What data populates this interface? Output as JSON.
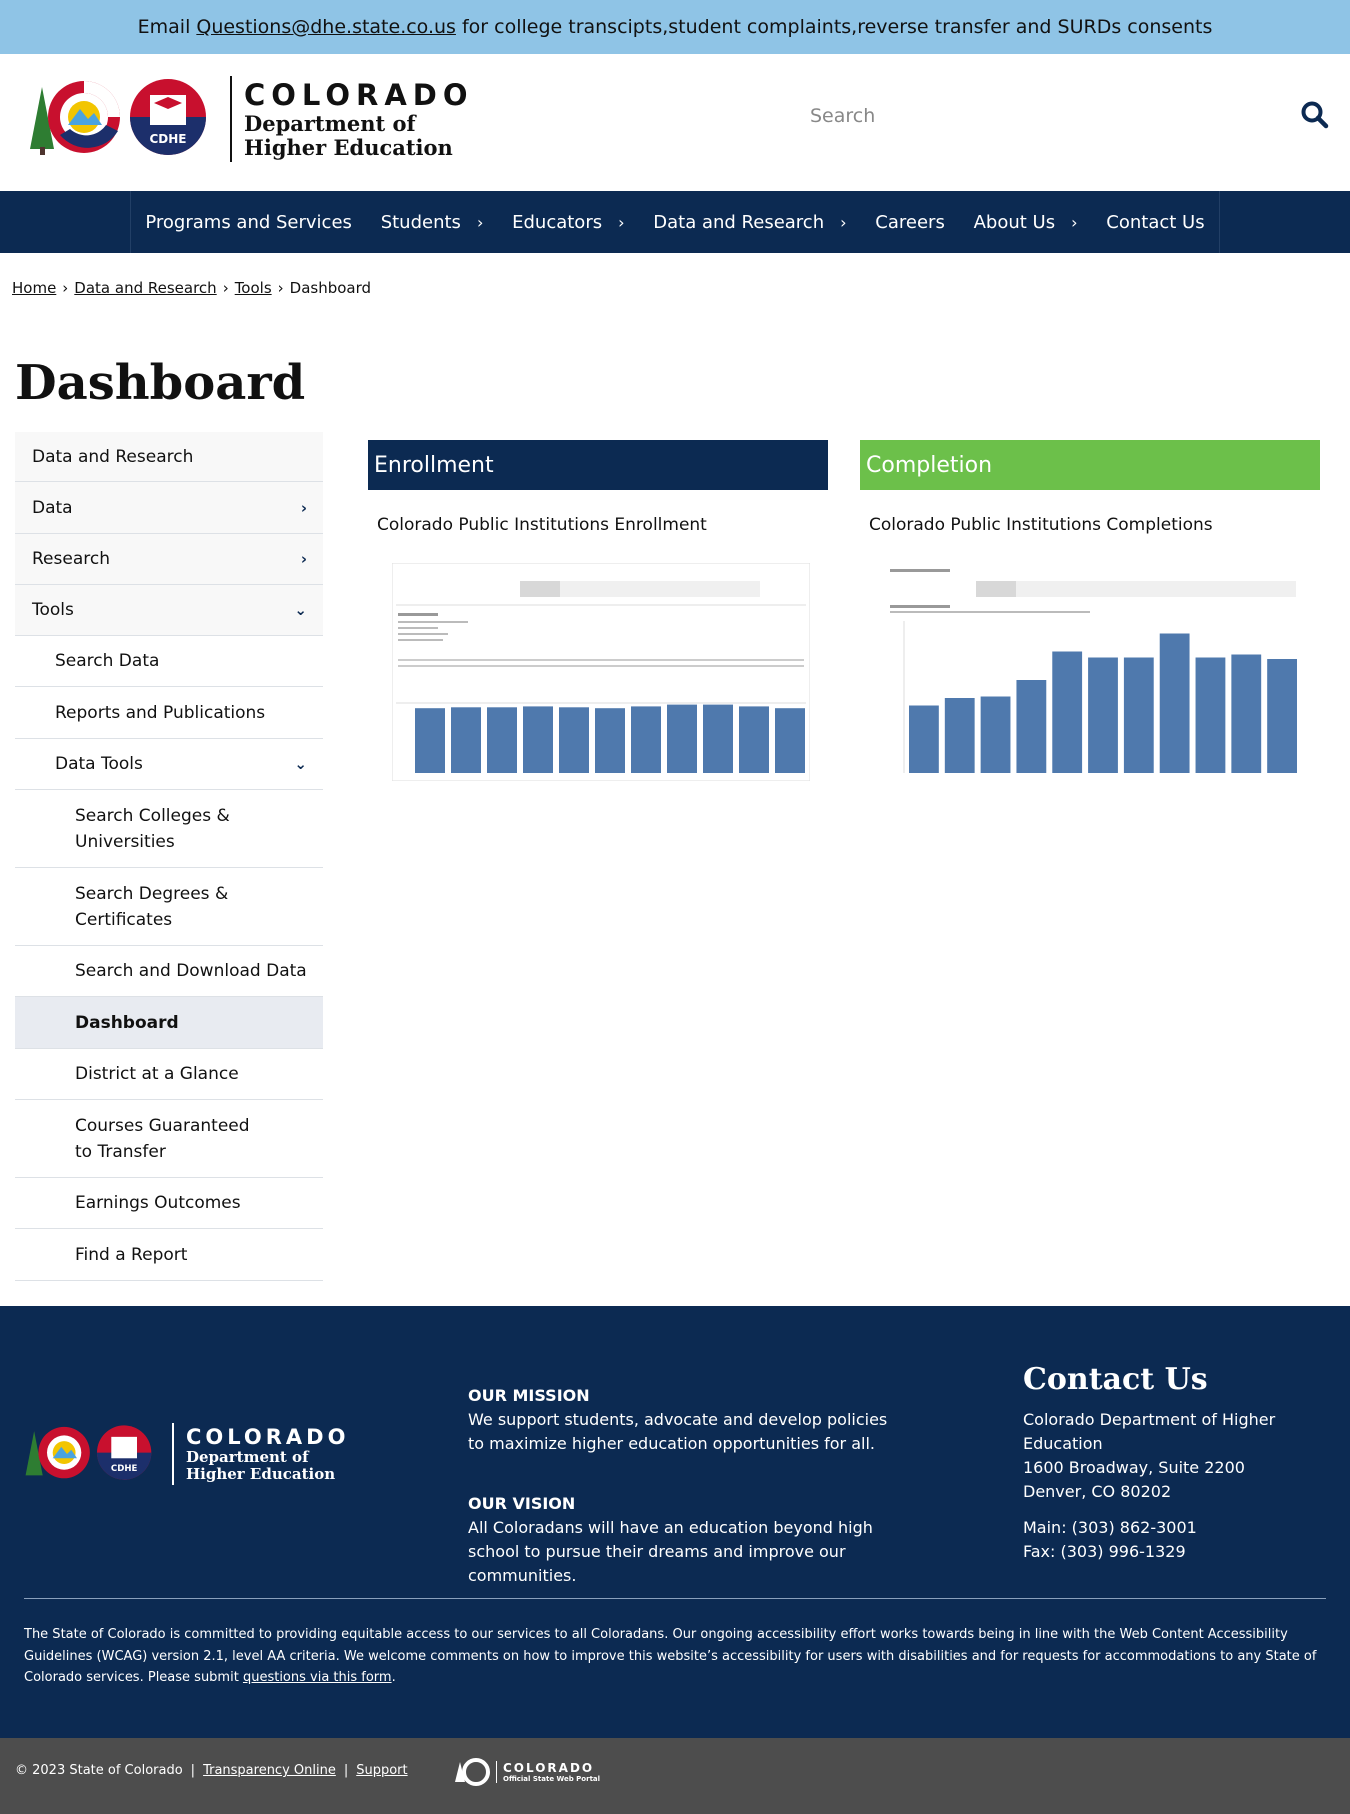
{
  "alert": {
    "prefix": "Email",
    "email": "Questions@dhe.state.co.us",
    "suffix": "for college transcipts,student complaints,reverse transfer and SURDs consents"
  },
  "brand": {
    "title": "COLORADO",
    "sub1": "Department of",
    "sub2": "Higher Education",
    "badge": "CDHE",
    "colors": {
      "navy": "#0c2a52",
      "red": "#c8102e",
      "green": "#6cc04a",
      "alert": "#8fc4e6"
    }
  },
  "search": {
    "placeholder": "Search"
  },
  "nav": {
    "items": [
      {
        "label": "Programs and Services",
        "chevron": ""
      },
      {
        "label": "Students",
        "chevron": "›"
      },
      {
        "label": "Educators",
        "chevron": "›"
      },
      {
        "label": "Data and Research",
        "chevron": "›"
      },
      {
        "label": "Careers",
        "chevron": ""
      },
      {
        "label": "About Us",
        "chevron": "›"
      },
      {
        "label": "Contact Us",
        "chevron": ""
      }
    ]
  },
  "breadcrumb": {
    "home": "Home",
    "data": "Data and Research",
    "tools": "Tools",
    "current": "Dashboard",
    "sep": "›"
  },
  "page": {
    "title": "Dashboard"
  },
  "sidebar": {
    "items": [
      {
        "label": "Data and Research",
        "chevron": ""
      },
      {
        "label": "Data",
        "chevron": "›"
      },
      {
        "label": "Research",
        "chevron": "›"
      },
      {
        "label": "Tools",
        "chevron": "⌄"
      },
      {
        "label": "Search Data",
        "chevron": ""
      },
      {
        "label": "Reports and Publications",
        "chevron": ""
      },
      {
        "label": "Data Tools",
        "chevron": "⌄"
      },
      {
        "label": "Search Colleges & Universities",
        "chevron": ""
      },
      {
        "label": "Search Degrees & Certificates",
        "chevron": ""
      },
      {
        "label": "Search and Download Data",
        "chevron": ""
      },
      {
        "label": "Dashboard",
        "chevron": ""
      },
      {
        "label": "District at a Glance",
        "chevron": ""
      },
      {
        "label": "Courses Guaranteed to Transfer",
        "chevron": ""
      },
      {
        "label": "Earnings Outcomes",
        "chevron": ""
      },
      {
        "label": "Find a Report",
        "chevron": ""
      }
    ]
  },
  "cards": {
    "enrollment": {
      "heading": "Enrollment",
      "subtitle": "Colorado Public Institutions Enrollment",
      "bars": [
        0.72,
        0.73,
        0.73,
        0.74,
        0.73,
        0.72,
        0.74,
        0.76,
        0.76,
        0.74,
        0.72
      ]
    },
    "completion": {
      "heading": "Completion",
      "subtitle": "Colorado Public Institutions Completions",
      "bars": [
        0.45,
        0.5,
        0.51,
        0.62,
        0.81,
        0.77,
        0.77,
        0.93,
        0.77,
        0.79,
        0.76
      ]
    }
  },
  "footer": {
    "mission_title": "OUR MISSION",
    "mission_text": "We support students, advocate and develop policies to maximize higher education opportunities for all.",
    "vision_title": "OUR VISION",
    "vision_text": "All Coloradans will have an education beyond high school to pursue their dreams and improve our communities.",
    "contact_title": "Contact Us",
    "contact_org": "Colorado Department of Higher Education",
    "contact_addr1": "1600 Broadway, Suite 2200",
    "contact_addr2": "Denver, CO 80202",
    "contact_main": "Main: (303) 862-3001",
    "contact_fax": "Fax: (303) 996-1329",
    "access_text": "The State of Colorado is committed to providing equitable access to our services to all Coloradans. Our ongoing accessibility effort works towards being in line with the Web Content Accessibility Guidelines (WCAG) version 2.1, level AA criteria. We welcome comments on how to improve this website’s accessibility for users with disabilities and for requests for accommodations to any State of Colorado services. Please submit",
    "access_link": "questions via this form",
    "access_end": "."
  },
  "bottom": {
    "copyright": "© 2023 State of Colorado",
    "sep": "|",
    "transparency": "Transparency Online",
    "support": "Support",
    "portal_title": "COLORADO",
    "portal_sub": "Official State Web Portal"
  }
}
